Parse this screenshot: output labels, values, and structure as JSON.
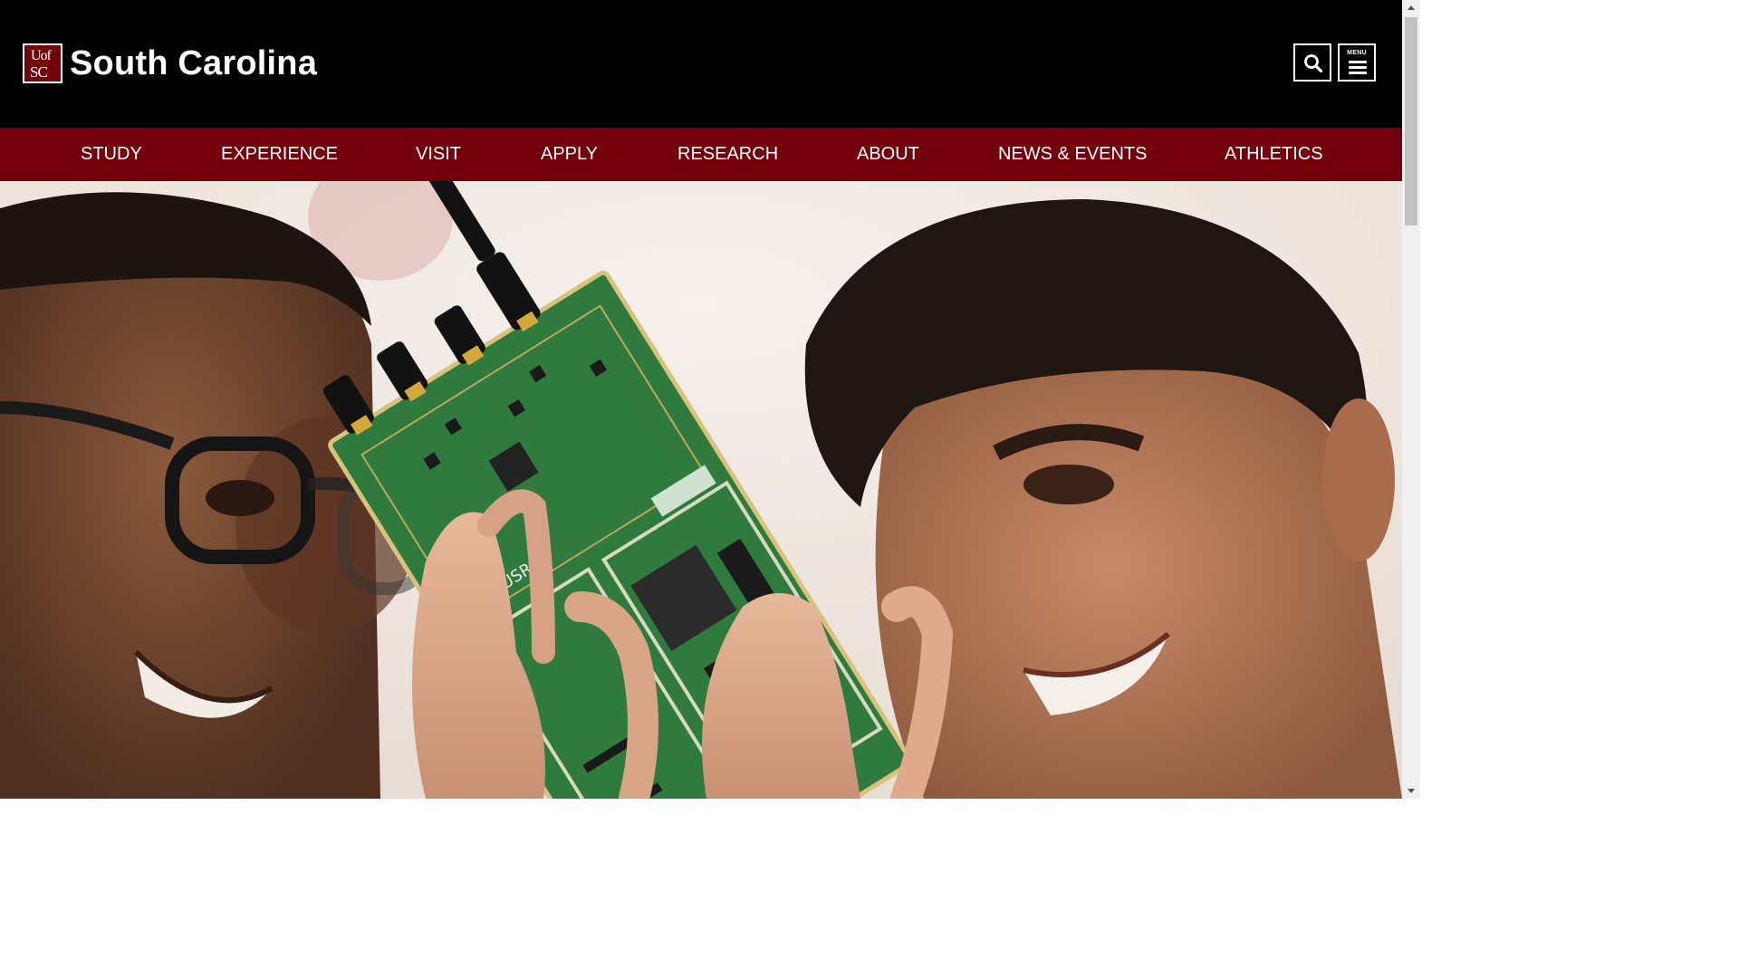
{
  "header": {
    "logo_line1": "Uof",
    "logo_line2": "SC",
    "site_title": "South Carolina",
    "search_icon": "search-icon",
    "menu_label": "MENU",
    "menu_icon": "hamburger-menu-icon"
  },
  "nav": {
    "items": [
      {
        "label": "STUDY"
      },
      {
        "label": "EXPERIENCE"
      },
      {
        "label": "VISIT"
      },
      {
        "label": "APPLY"
      },
      {
        "label": "RESEARCH"
      },
      {
        "label": "ABOUT"
      },
      {
        "label": "NEWS & EVENTS"
      },
      {
        "label": "ATHLETICS"
      }
    ]
  },
  "hero": {
    "board_label": "USRP"
  },
  "colors": {
    "garnet": "#73000a",
    "header_bg": "#000000",
    "text": "#ffffff",
    "board_green": "#2f7a3d"
  }
}
